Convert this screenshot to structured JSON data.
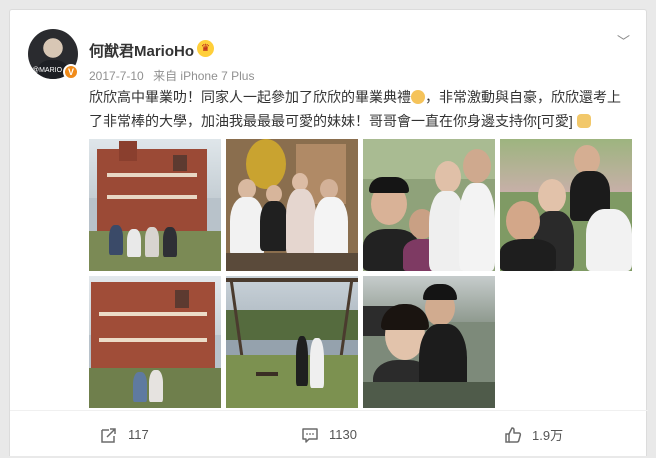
{
  "post": {
    "author": "何猷君MarioHo",
    "verified_badge": "V",
    "crown_symbol": "♛",
    "avatar_tag": "@MARIO",
    "date": "2017-7-10",
    "source": "来自 iPhone 7 Plus",
    "more_symbol": "﹀",
    "text_line1": "欣欣高中畢業叻！同家人一起參加了欣欣的畢業典禮",
    "text_line1_cont": "，非常激動與自豪，欣欣還考上",
    "text_line2": "了非常棒的大學，加油我最最最可愛的妹妹！哥哥會一直在你身邊支持你[可愛]",
    "photos": [
      {
        "subject": "college-building-family",
        "palette": "brick"
      },
      {
        "subject": "family-group-indoor",
        "palette": "warm"
      },
      {
        "subject": "selfie-family",
        "palette": "green"
      },
      {
        "subject": "selfie-crowd",
        "palette": "green"
      },
      {
        "subject": "college-building",
        "palette": "brick"
      },
      {
        "subject": "swing-garden",
        "palette": "garden"
      },
      {
        "subject": "selfie-siblings",
        "palette": "street"
      }
    ]
  },
  "actions": {
    "share_count": "117",
    "comment_count": "1130",
    "like_count": "1.9万"
  },
  "colors": {
    "background": "#e9e9e9",
    "card": "#ffffff",
    "text": "#333333",
    "meta": "#909090",
    "badge": "#f08b1a"
  },
  "icons": {
    "share": "share-icon",
    "comment": "comment-icon",
    "like": "thumbs-up-icon"
  }
}
